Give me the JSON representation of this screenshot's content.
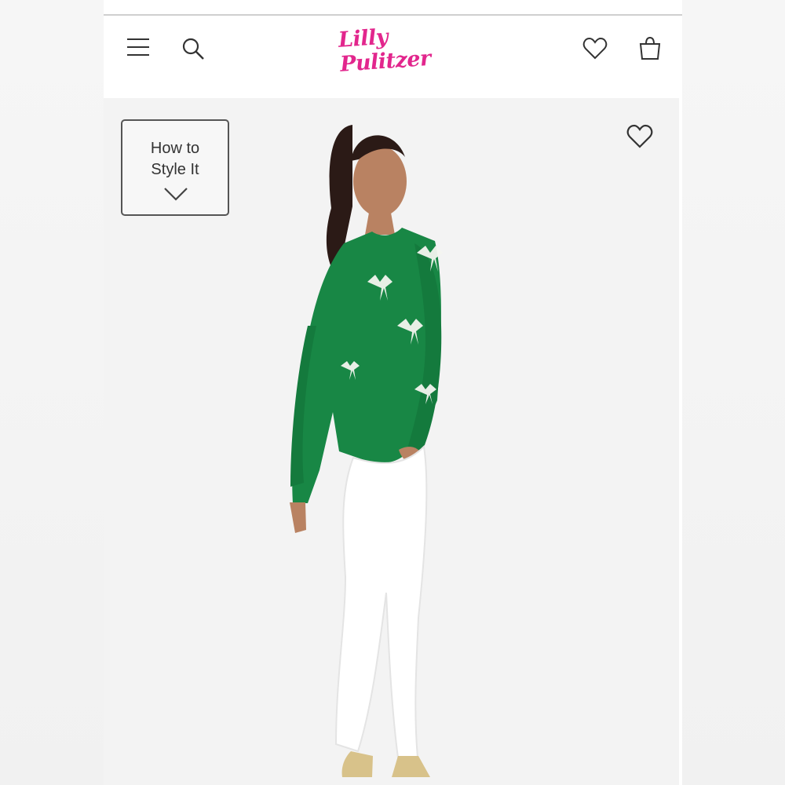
{
  "header": {
    "brand": "Lilly Pulitzer",
    "icons": {
      "menu": "menu-icon",
      "search": "search-icon",
      "wishlist": "heart-icon",
      "bag": "shopping-bag-icon"
    }
  },
  "hero": {
    "style_button_label": "How to\nStyle It",
    "style_button_icon": "chevron-down-icon",
    "favorite_icon": "heart-icon",
    "image_alt": "Model wearing green sweatshirt with white bow embellishments and white jeans"
  },
  "colors": {
    "brand_pink": "#e2268d",
    "sweater_green": "#188745",
    "background": "#f3f3f3"
  }
}
